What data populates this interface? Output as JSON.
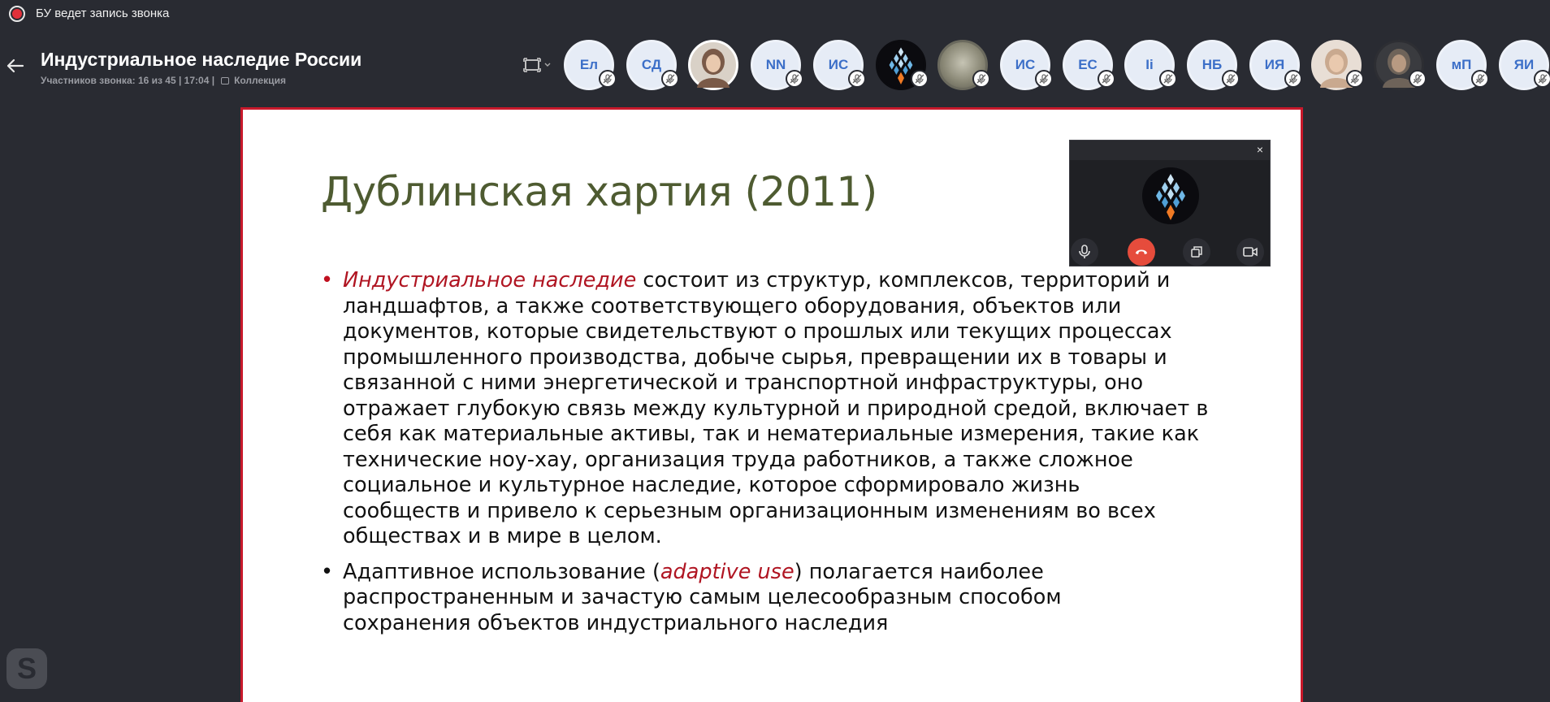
{
  "recording": {
    "text": "БУ ведет запись звонка"
  },
  "header": {
    "title": "Индустриальное наследие России",
    "info": "Участников звонка: 16 из 45 | 17:04 |",
    "collection": "Коллекция"
  },
  "participants": [
    {
      "initials": "Ел",
      "kind": "initials"
    },
    {
      "initials": "СД",
      "kind": "initials"
    },
    {
      "initials": "",
      "kind": "photo-active"
    },
    {
      "initials": "NN",
      "kind": "initials"
    },
    {
      "initials": "ИС",
      "kind": "initials"
    },
    {
      "initials": "",
      "kind": "photo-brand"
    },
    {
      "initials": "",
      "kind": "photo-blur"
    },
    {
      "initials": "ИС",
      "kind": "initials"
    },
    {
      "initials": "ЕС",
      "kind": "initials"
    },
    {
      "initials": "Ii",
      "kind": "initials"
    },
    {
      "initials": "НБ",
      "kind": "initials"
    },
    {
      "initials": "ИЯ",
      "kind": "initials"
    },
    {
      "initials": "",
      "kind": "photo-light"
    },
    {
      "initials": "",
      "kind": "photo-dark"
    },
    {
      "initials": "мП",
      "kind": "initials"
    },
    {
      "initials": "ЯИ",
      "kind": "initials"
    }
  ],
  "slide": {
    "title": "Дублинская хартия (2011)",
    "bullet1": {
      "emph": "Индустриальное наследие",
      "line1_rest": " состоит из структур, комплексов, территорий и",
      "lines": [
        "ландшафтов, а также соответствующего оборудования, объектов или",
        "документов, которые свидетельствуют о прошлых или текущих процессах",
        "промышленного производства, добыче сырья, превращении их в товары и",
        "связанной с ними энергетической и транспортной инфраструктуры, оно",
        "отражает глубокую связь между культурной и природной средой, включает в",
        "себя как материальные активы, так и нематериальные измерения, такие как",
        "технические ноу-хау, организация труда работников, а также сложное",
        "социальное и культурное наследие, которое сформировало жизнь",
        "сообществ и привело к серьезным организационным изменениям во всех",
        "обществах и в мире в целом."
      ]
    },
    "bullet2": {
      "pre": "Адаптивное использование (",
      "emph": "adaptive use",
      "post": ") полагается наиболее",
      "lines": [
        "распространенным и зачастую самым целесообразным способом",
        "сохранения объектов индустриального наследия"
      ]
    }
  },
  "mini_window": {
    "close": "×"
  },
  "colors": {
    "background": "#292b32",
    "slide_border": "#c8192b",
    "title_green": "#4e5b31",
    "accent_red": "#b01522",
    "hangup": "#e64c3c"
  }
}
